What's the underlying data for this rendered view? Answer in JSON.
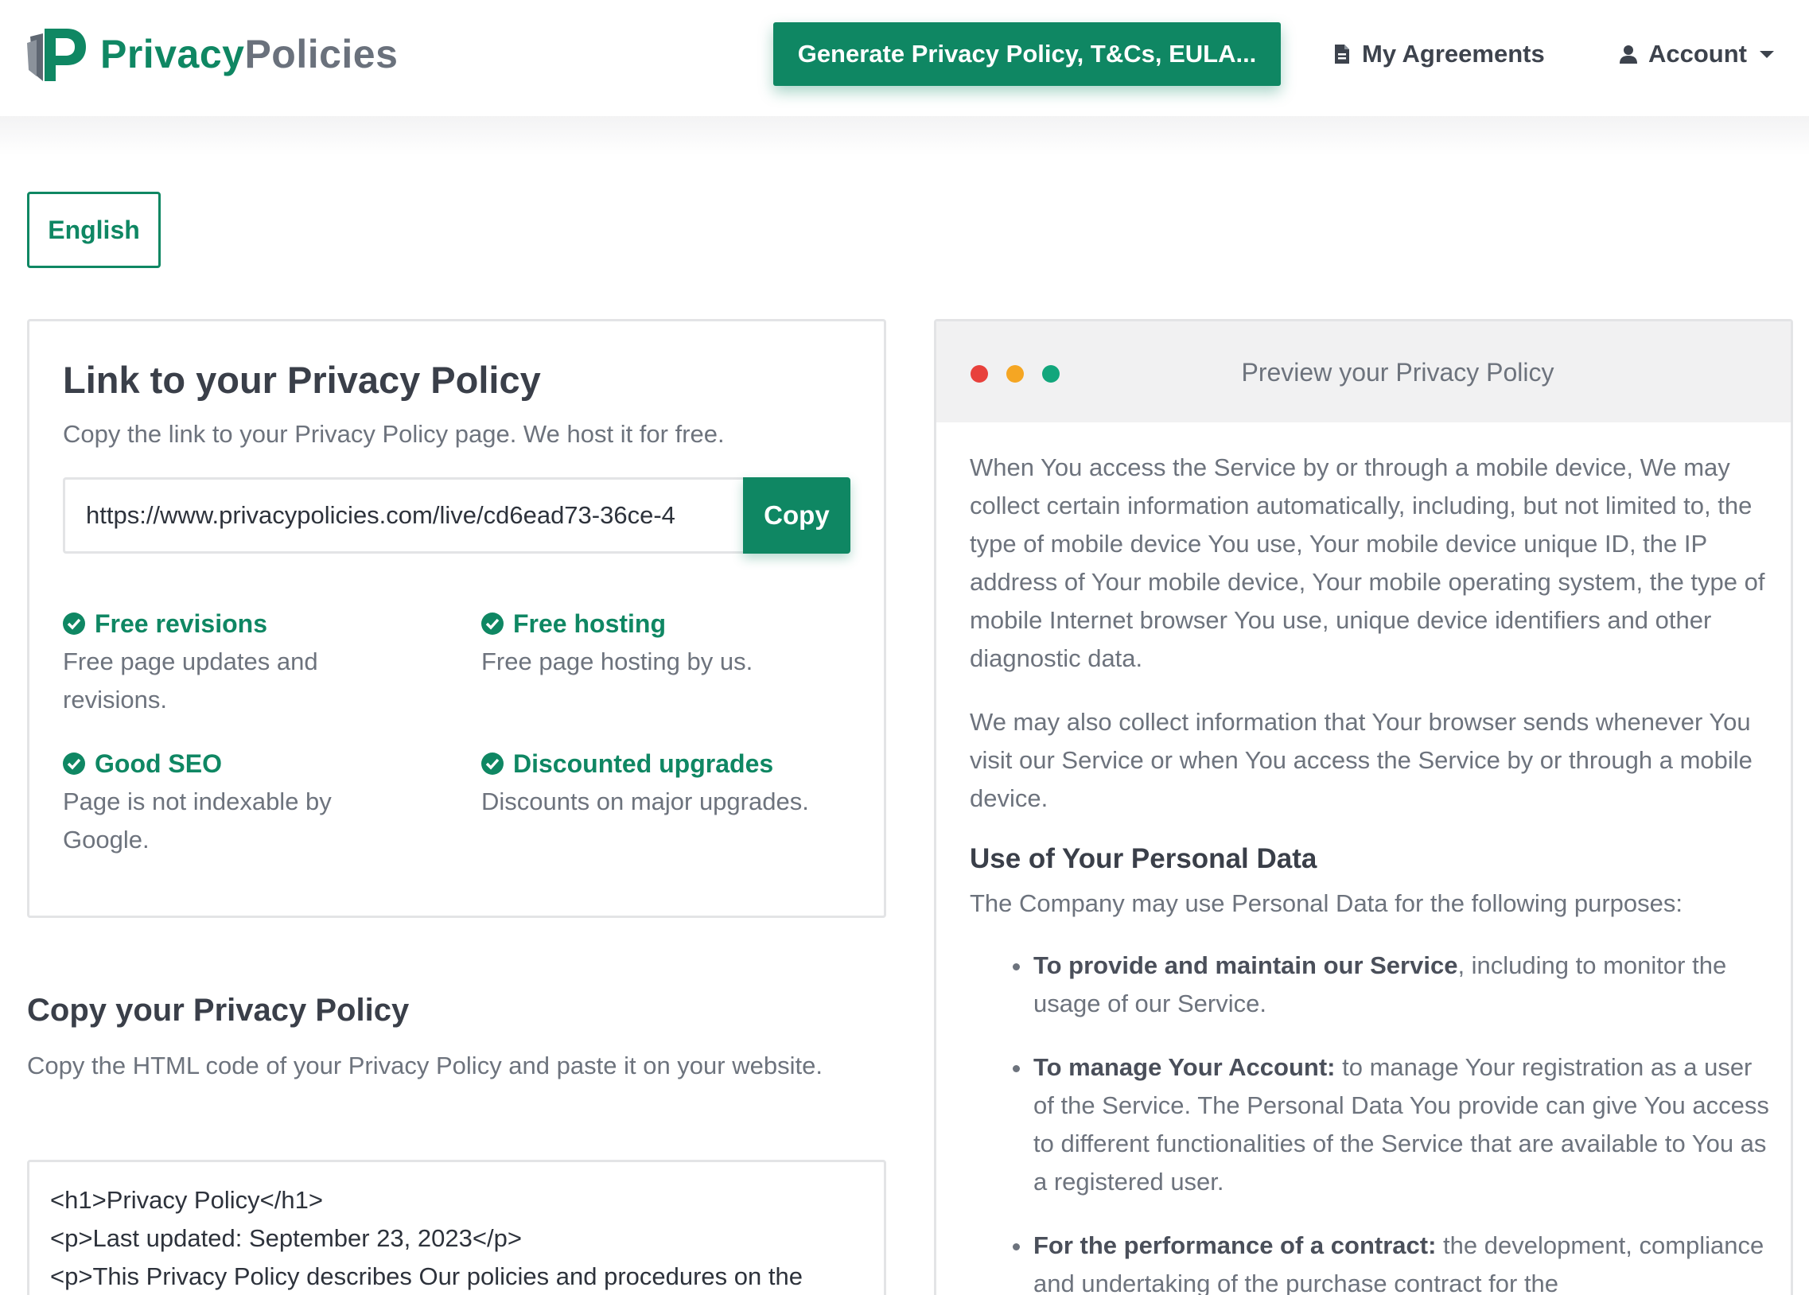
{
  "header": {
    "logo_part1": "Privacy",
    "logo_part2": "Policies",
    "generate_button": "Generate Privacy Policy, T&Cs, EULA...",
    "my_agreements": "My Agreements",
    "account": "Account"
  },
  "language": {
    "selected": "English"
  },
  "link_card": {
    "title": "Link to your Privacy Policy",
    "subtitle": "Copy the link to your Privacy Policy page. We host it for free.",
    "url": "https://www.privacypolicies.com/live/cd6ead73-36ce-4",
    "copy_button": "Copy",
    "features": [
      {
        "title": "Free revisions",
        "desc": "Free page updates and revisions."
      },
      {
        "title": "Free hosting",
        "desc": "Free page hosting by us."
      },
      {
        "title": "Good SEO",
        "desc": "Page is not indexable by Google."
      },
      {
        "title": "Discounted upgrades",
        "desc": "Discounts on major upgrades."
      }
    ]
  },
  "copy_section": {
    "title": "Copy your Privacy Policy",
    "subtitle": "Copy the HTML code of your Privacy Policy and paste it on your website.",
    "code_lines": [
      "<h1>Privacy Policy</h1>",
      "<p>Last updated: September 23, 2023</p>",
      "<p>This Privacy Policy describes Our policies and procedures on the"
    ]
  },
  "preview": {
    "title": "Preview your Privacy Policy",
    "para1": "When You access the Service by or through a mobile device, We may collect certain information automatically, including, but not limited to, the type of mobile device You use, Your mobile device unique ID, the IP address of Your mobile device, Your mobile operating system, the type of mobile Internet browser You use, unique device identifiers and other diagnostic data.",
    "para2": "We may also collect information that Your browser sends whenever You visit our Service or when You access the Service by or through a mobile device.",
    "heading": "Use of Your Personal Data",
    "intro": "The Company may use Personal Data for the following purposes:",
    "items": [
      {
        "bold": "To provide and maintain our Service",
        "text": ", including to monitor the usage of our Service."
      },
      {
        "bold": "To manage Your Account:",
        "text": " to manage Your registration as a user of the Service. The Personal Data You provide can give You access to different functionalities of the Service that are available to You as a registered user."
      },
      {
        "bold": "For the performance of a contract:",
        "text": " the development, compliance and undertaking of the purchase contract for the"
      }
    ]
  },
  "colors": {
    "brand": "#0f8763",
    "text": "#6d737d",
    "heading": "#3a3f49"
  }
}
